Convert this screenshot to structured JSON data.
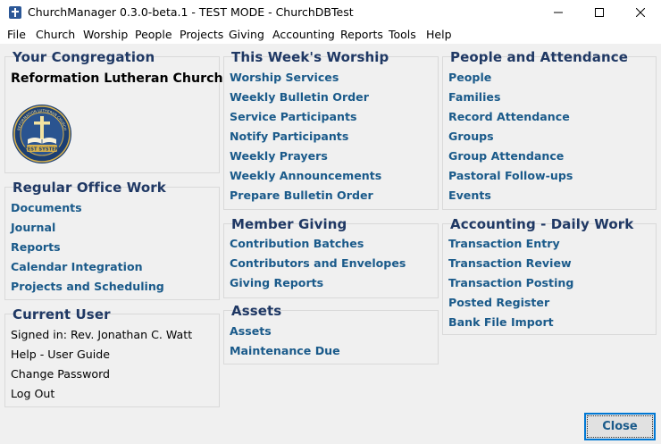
{
  "window": {
    "title": "ChurchManager 0.3.0-beta.1 - TEST MODE - ChurchDBTest"
  },
  "menu": [
    "File",
    "Church",
    "Worship",
    "People",
    "Projects",
    "Giving",
    "Accounting",
    "Reports",
    "Tools",
    "Help"
  ],
  "congregation": {
    "title": "Your Congregation",
    "church_name": "Reformation Lutheran Church",
    "logo_top_text": "REFORMATION LUTHERAN CHURCH",
    "logo_badge": "TEST SYSTEM"
  },
  "office": {
    "title": "Regular Office Work",
    "links": [
      "Documents",
      "Journal",
      "Reports",
      "Calendar Integration",
      "Projects and Scheduling"
    ]
  },
  "current_user": {
    "title": "Current User",
    "signed_in": "Signed in: Rev. Jonathan C. Watt",
    "items": [
      "Help - User Guide",
      "Change Password",
      "Log Out"
    ]
  },
  "worship": {
    "title": "This Week's Worship",
    "links": [
      "Worship Services",
      "Weekly Bulletin Order",
      "Service Participants",
      "Notify Participants",
      "Weekly Prayers",
      "Weekly Announcements",
      "Prepare Bulletin Order"
    ]
  },
  "giving": {
    "title": "Member Giving",
    "links": [
      "Contribution Batches",
      "Contributors and Envelopes",
      "Giving Reports"
    ]
  },
  "assets": {
    "title": "Assets",
    "links": [
      "Assets",
      "Maintenance Due"
    ]
  },
  "people": {
    "title": "People and Attendance",
    "links": [
      "People",
      "Families",
      "Record Attendance",
      "Groups",
      "Group Attendance",
      "Pastoral Follow-ups",
      "Events"
    ]
  },
  "accounting": {
    "title": "Accounting - Daily Work",
    "links": [
      "Transaction Entry",
      "Transaction Review",
      "Transaction Posting",
      "Posted Register",
      "Bank File Import"
    ]
  },
  "footer": {
    "close_label": "Close"
  },
  "colors": {
    "heading": "#1f3864",
    "link": "#1a5a8a",
    "accent": "#0078d4"
  }
}
